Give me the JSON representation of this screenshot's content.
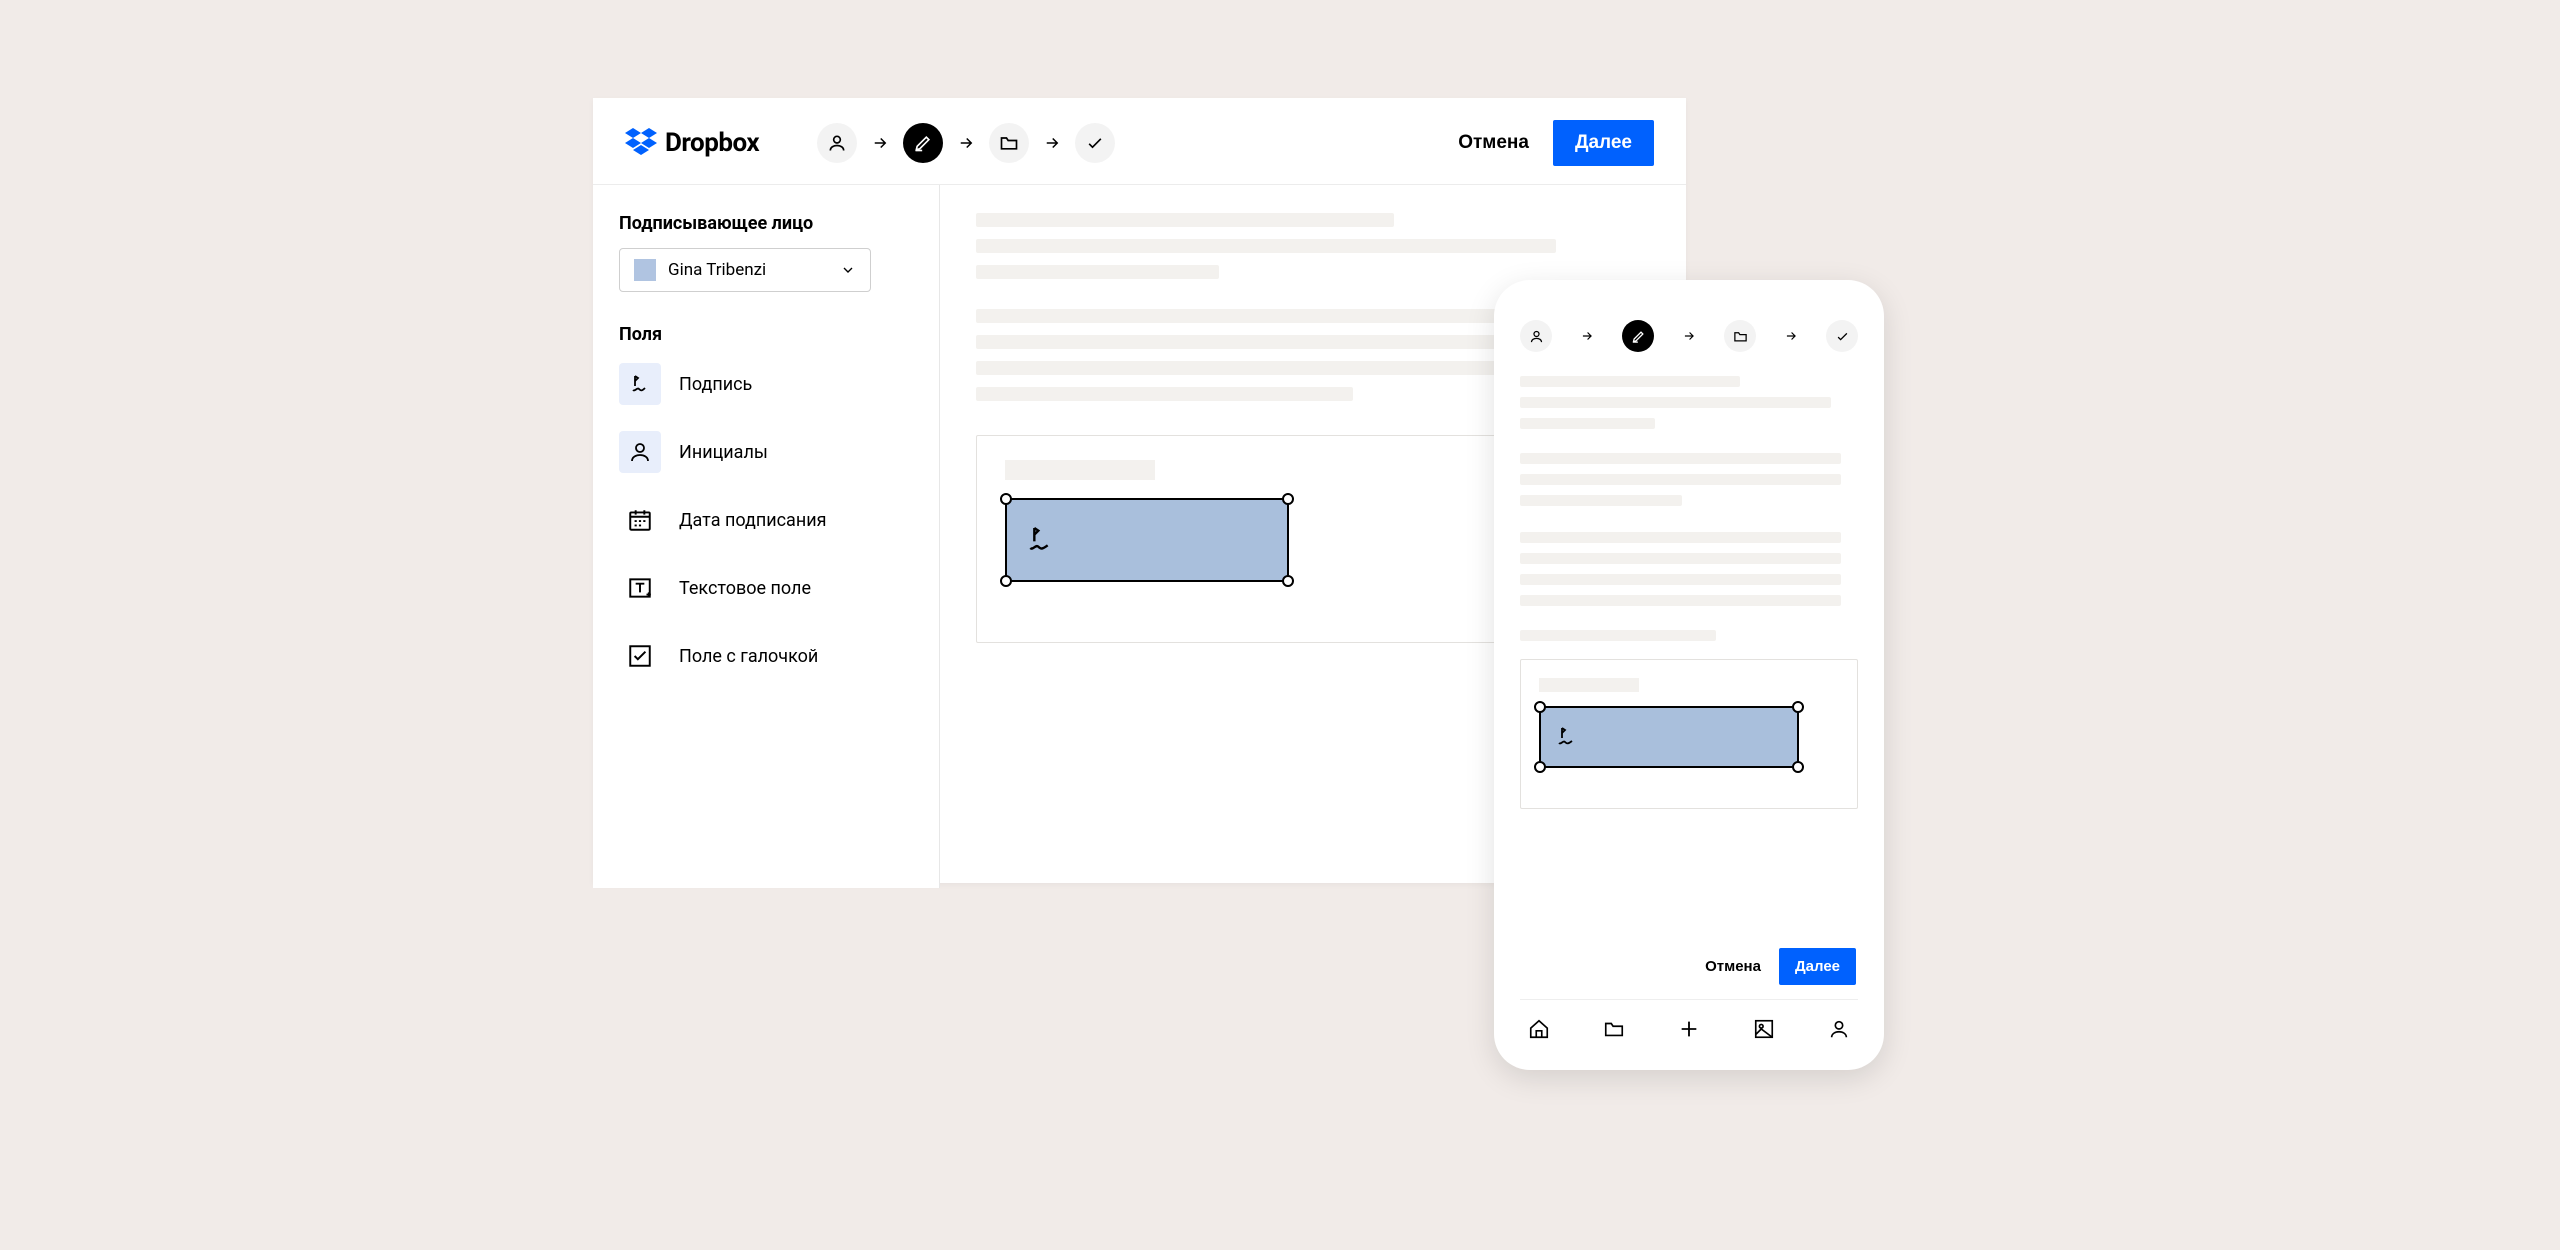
{
  "brand": {
    "name": "Dropbox"
  },
  "wizard": {
    "cancel": "Отмена",
    "next": "Далее"
  },
  "signer": {
    "heading": "Подписывающее лицо",
    "selected": "Gina Tribenzi"
  },
  "fields_heading": "Поля",
  "fields": [
    {
      "label": "Подпись"
    },
    {
      "label": "Инициалы"
    },
    {
      "label": "Дата подписания"
    },
    {
      "label": "Текстовое поле"
    },
    {
      "label": "Поле с галочкой"
    }
  ],
  "mobile": {
    "cancel": "Отмена",
    "next": "Далее"
  }
}
